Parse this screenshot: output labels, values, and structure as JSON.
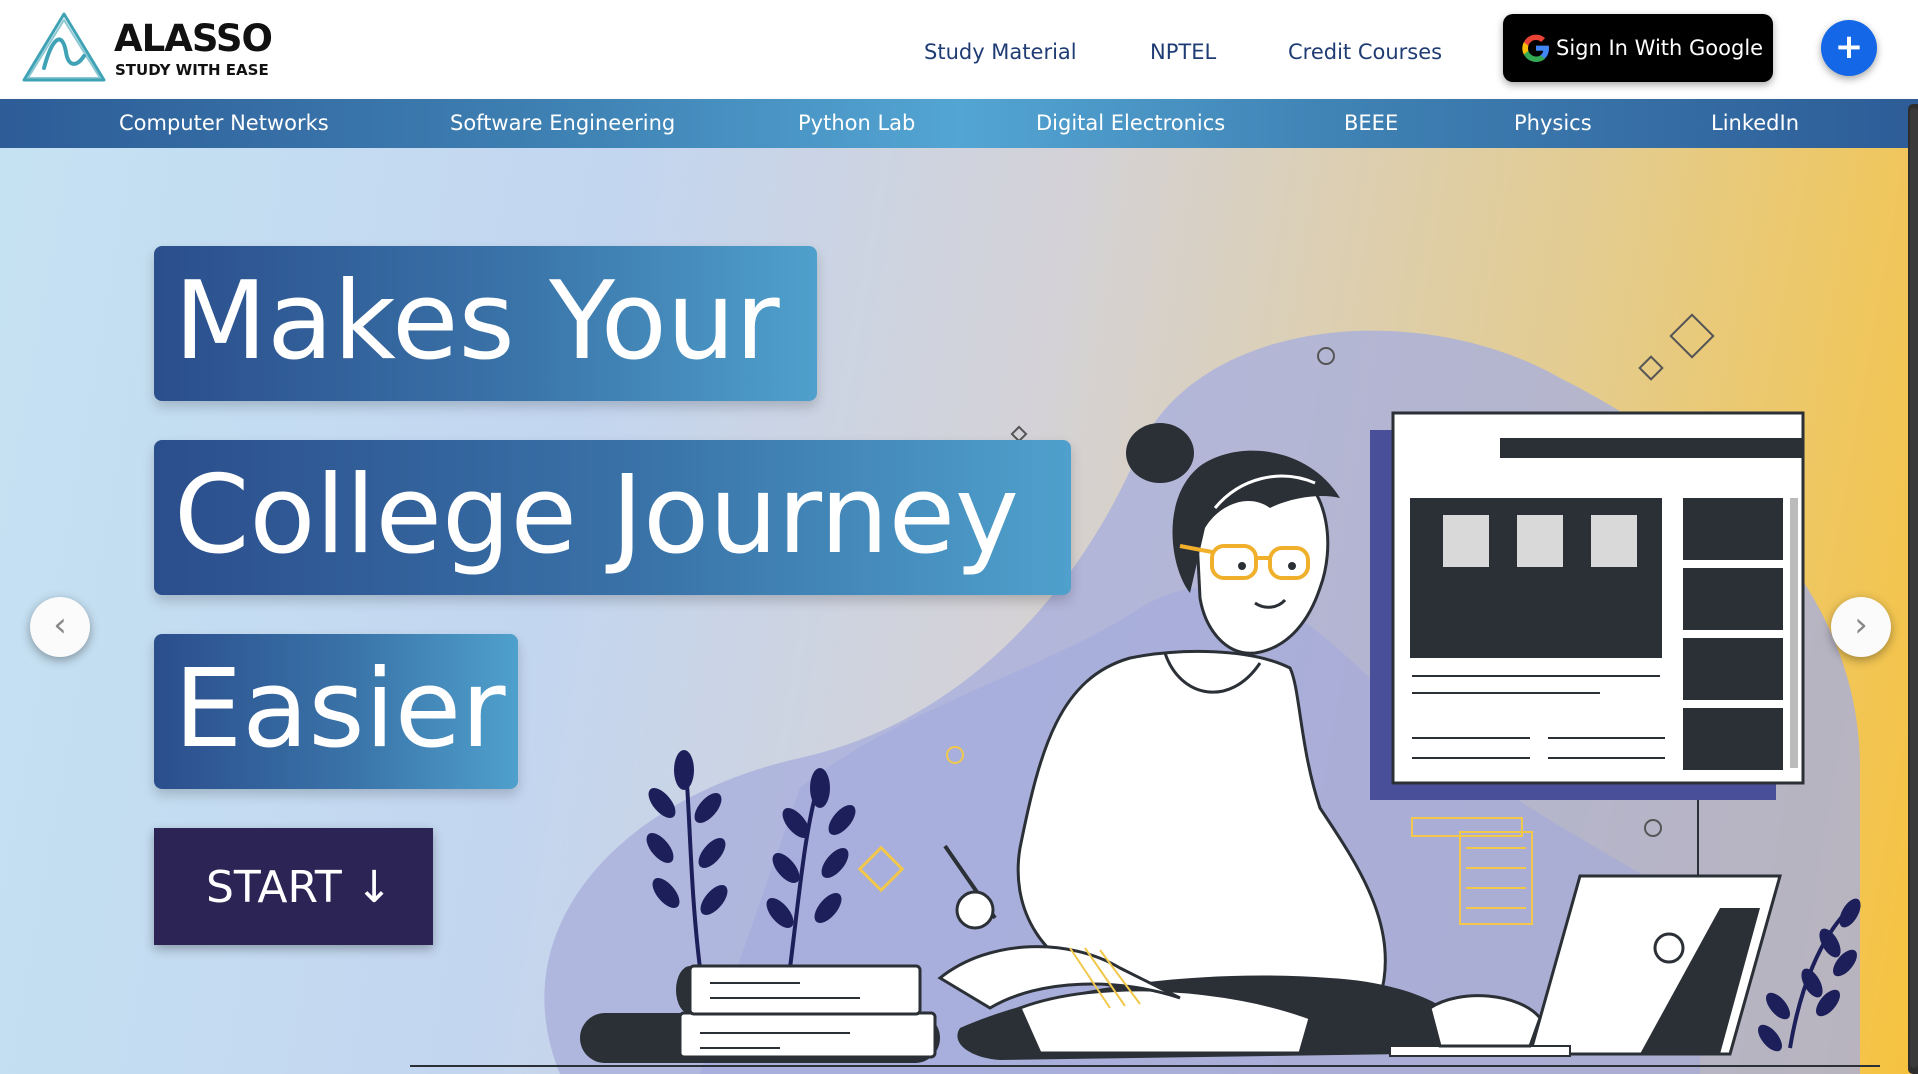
{
  "brand": {
    "name": "ALASSO",
    "tagline": "STUDY WITH EASE",
    "logo_icon": "alasso-logo-icon"
  },
  "top_nav": {
    "links": [
      {
        "label": "Study Material"
      },
      {
        "label": "NPTEL"
      },
      {
        "label": "Credit Courses"
      }
    ],
    "sign_in_label": "Sign In With Google",
    "google_icon": "google-g-icon",
    "plus_label": "+"
  },
  "sub_nav": {
    "items": [
      {
        "label": "Computer Networks"
      },
      {
        "label": "Software Engineering"
      },
      {
        "label": "Python Lab"
      },
      {
        "label": "Digital Electronics"
      },
      {
        "label": "BEEE"
      },
      {
        "label": "Physics"
      },
      {
        "label": "LinkedIn"
      }
    ]
  },
  "hero": {
    "headline_lines": [
      "Makes Your",
      "College Journey",
      "Easier"
    ],
    "start_label": "START ↓",
    "prev_icon": "‹",
    "next_icon": "›",
    "illustration": "student-studying-illustration"
  },
  "colors": {
    "header_text": "#1f3c74",
    "accent_blue": "#1467e6",
    "start_button": "#2d2456",
    "hero_gradient_start": "#c5e2f2",
    "hero_gradient_end": "#f7c33e"
  }
}
